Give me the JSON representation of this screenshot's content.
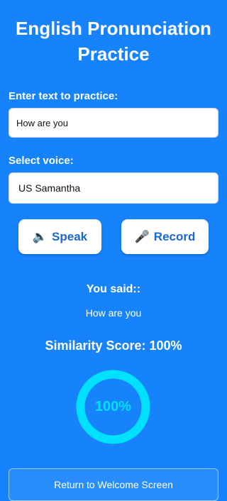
{
  "header": {
    "title_line1": "English Pronunciation",
    "title_line2": "Practice"
  },
  "practice_text": {
    "label": "Enter text to practice:",
    "value": "How are you"
  },
  "voice": {
    "label": "Select voice:",
    "selected": "US Samantha"
  },
  "actions": {
    "speak_icon": "🔈",
    "speak_label": "Speak",
    "record_icon": "🎤",
    "record_label": "Record"
  },
  "result": {
    "heading": "You said::",
    "transcript": "How are you",
    "score_label": "Similarity Score: 100%",
    "gauge_text": "100%",
    "score_fraction": 1.0
  },
  "footer": {
    "return_label": "Return to Welcome Screen"
  },
  "colors": {
    "background": "#1783fb",
    "gauge": "#00e1ff",
    "button_text": "#1768d6"
  }
}
